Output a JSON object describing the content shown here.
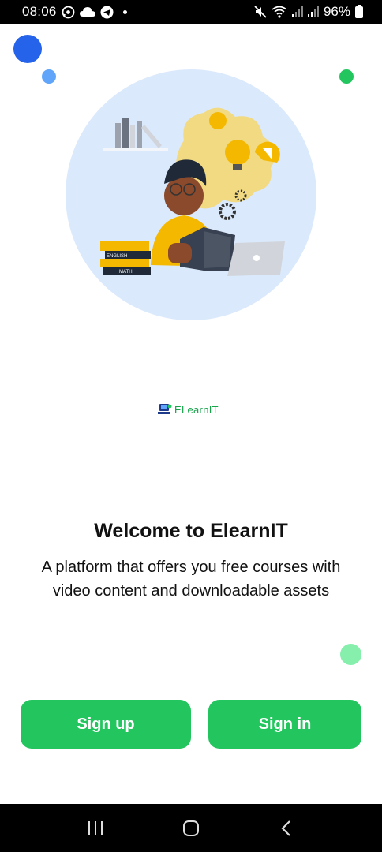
{
  "status_bar": {
    "time": "08:06",
    "battery": "96%",
    "icons_left": [
      "whatsapp-icon",
      "cloud-icon",
      "telegram-icon",
      "notification-dot"
    ],
    "icons_right": [
      "mute-icon",
      "wifi-icon",
      "signal-1-icon",
      "signal-2-icon",
      "battery-icon"
    ]
  },
  "logo": {
    "text": "ELearnIT"
  },
  "welcome": {
    "title": "Welcome to ElearnIT",
    "subtitle": "A platform that offers you free courses with video content and downloadable assets"
  },
  "buttons": {
    "signup": "Sign up",
    "signin": "Sign in"
  },
  "illustration": {
    "book_labels": [
      "ENGLISH",
      "MATH"
    ]
  },
  "colors": {
    "accent_green": "#22c55e",
    "hero_bg": "#dbe9fc",
    "dot_blue": "#2563eb",
    "dot_light_blue": "#60a5fa",
    "dot_light_green": "#86efac"
  },
  "nav": {
    "icons": [
      "recent-apps-icon",
      "home-icon",
      "back-icon"
    ]
  }
}
